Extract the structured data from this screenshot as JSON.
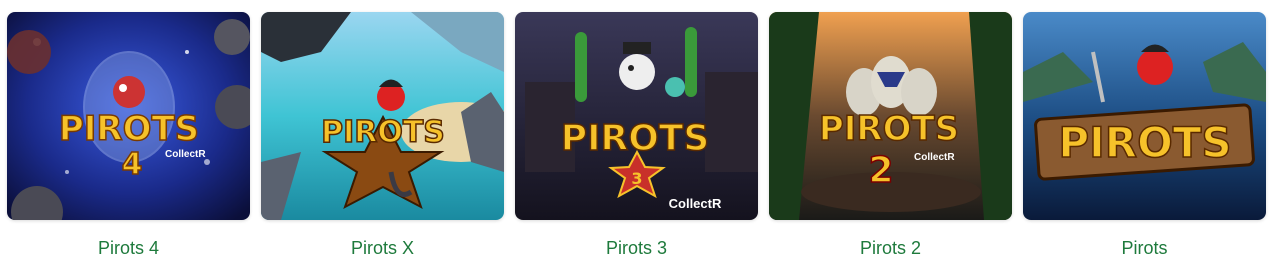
{
  "accent_color": "#1e7a3c",
  "games": [
    {
      "title": "Pirots 4",
      "logo": "PIROTS",
      "badge": "4",
      "brand": "CollectR",
      "theme": "space"
    },
    {
      "title": "Pirots X",
      "logo": "PIROTS",
      "badge": "",
      "brand": "",
      "theme": "beach"
    },
    {
      "title": "Pirots 3",
      "logo": "PIROTS",
      "badge": "3",
      "brand": "CollectR",
      "theme": "western"
    },
    {
      "title": "Pirots 2",
      "logo": "PIROTS",
      "badge": "2",
      "brand": "CollectR",
      "theme": "jungle"
    },
    {
      "title": "Pirots",
      "logo": "PIROTS",
      "badge": "",
      "brand": "",
      "theme": "ocean"
    }
  ]
}
